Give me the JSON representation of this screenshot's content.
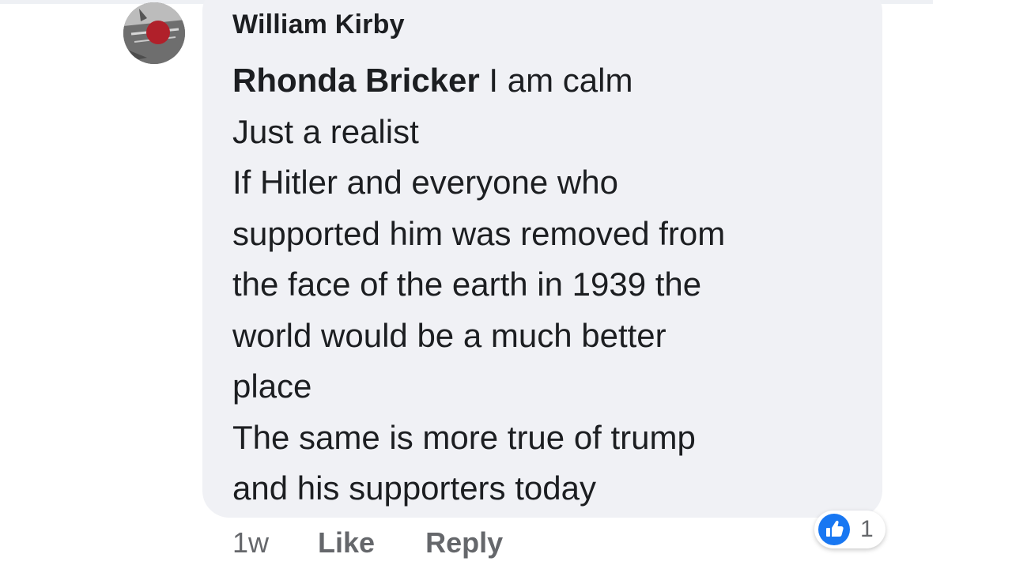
{
  "comment": {
    "author": "William Kirby",
    "mention": "Rhonda Bricker",
    "first_line_rest": " I am calm",
    "lines": [
      "Just a realist",
      "If Hitler and everyone who",
      "supported him was removed from",
      "the face of the earth in 1939 the",
      "world would be a much better",
      "place",
      "The same is more true of trump",
      "and his supporters today"
    ],
    "timestamp": "1w",
    "like_label": "Like",
    "reply_label": "Reply",
    "reaction_count": "1",
    "reaction_type": "thumbs-up-icon"
  },
  "colors": {
    "bubble": "#f0f1f5",
    "text": "#1c1e21",
    "secondary": "#65676b",
    "like_blue": "#1877f2"
  }
}
